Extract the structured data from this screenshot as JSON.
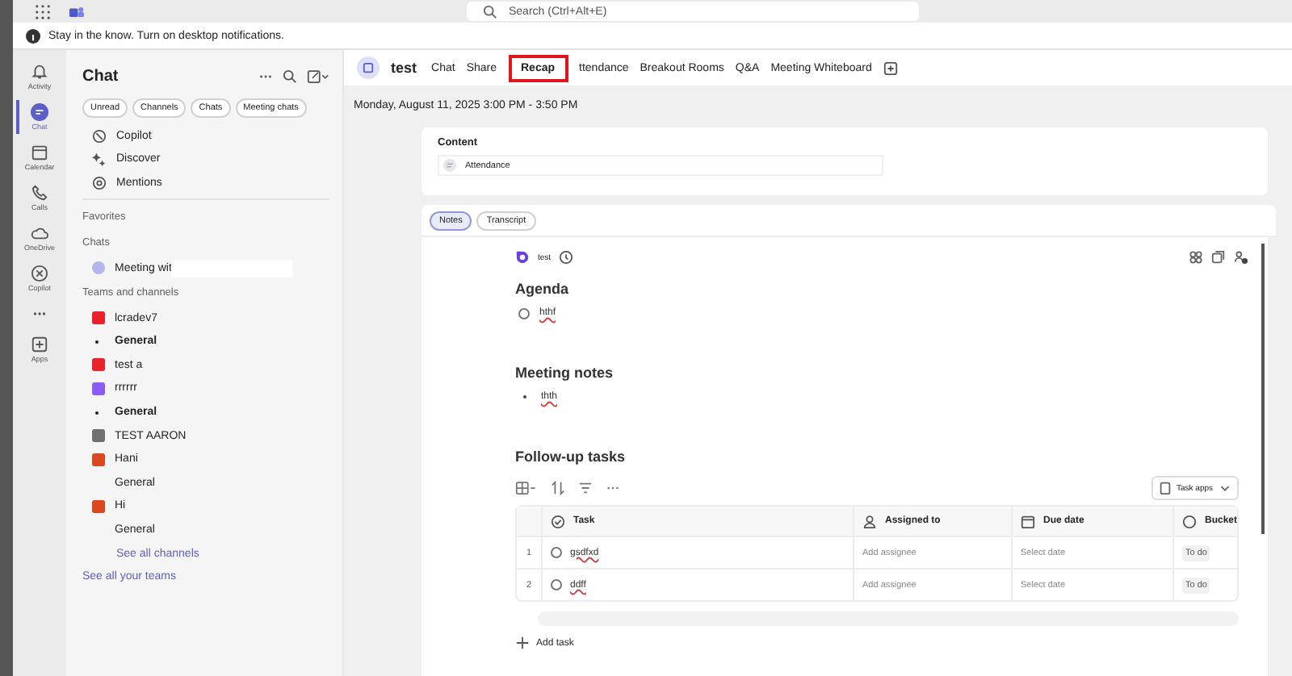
{
  "top_bar": {
    "search": {
      "placeholder": "Search (Ctrl+Alt+E)"
    }
  },
  "notification": {
    "text": "Stay in the know. Turn on desktop notifications."
  },
  "rail": [
    {
      "label": "Activity",
      "selected": false
    },
    {
      "label": "Chat",
      "selected": true
    },
    {
      "label": "Calendar",
      "selected": false
    },
    {
      "label": "Calls",
      "selected": false
    },
    {
      "label": "OneDrive",
      "selected": false
    },
    {
      "label": "Copilot",
      "selected": false
    },
    {
      "selected": false
    },
    {
      "label": "Apps",
      "selected": false
    }
  ],
  "chat_pane": {
    "title": "Chat",
    "filters": [
      "Unread",
      "Channels",
      "Chats",
      "Meeting chats"
    ],
    "shortcuts": [
      "Copilot",
      "Discover",
      "Mentions"
    ],
    "favorites_label": "Favorites",
    "chats_label": "Chats",
    "chats": [
      {
        "name": "Meeting wit",
        "redacted": true
      }
    ],
    "teams_label": "Teams and channels",
    "teams": [
      {
        "name": "lcradev7",
        "color": "#e8212b",
        "channels": [
          {
            "name": "General",
            "bold": true
          }
        ]
      },
      {
        "name": "test a",
        "color": "#e8212b"
      },
      {
        "name": "rrrrrr",
        "color": "#8b5cf6",
        "channels": [
          {
            "name": "General",
            "bold": true
          }
        ]
      },
      {
        "name": "TEST AARON",
        "color": "#707070"
      },
      {
        "name": "Hani",
        "color": "#d9481e",
        "channels": [
          {
            "name": "General",
            "bold": false
          }
        ]
      },
      {
        "name": "Hi",
        "color": "#d9481e",
        "channels": [
          {
            "name": "General",
            "bold": false
          }
        ]
      }
    ],
    "see_all_channels": "See all channels",
    "see_all_teams": "See all your teams"
  },
  "meeting": {
    "title": "test",
    "tabs": [
      {
        "label": "Chat",
        "selected": false,
        "highlighted": false
      },
      {
        "label": "Share",
        "selected": false,
        "highlighted": false
      },
      {
        "label": "Recap",
        "selected": true,
        "highlighted": true
      },
      {
        "label": "ttendance",
        "selected": false,
        "highlighted": false
      },
      {
        "label": "Breakout Rooms",
        "selected": false,
        "highlighted": false
      },
      {
        "label": "Q&A",
        "selected": false,
        "highlighted": false
      },
      {
        "label": "Meeting Whiteboard",
        "selected": false,
        "highlighted": false
      }
    ],
    "date": "Monday, August 11, 2025 3:00 PM - 3:50 PM",
    "content": {
      "title": "Content",
      "file": "Attendance"
    },
    "views": [
      {
        "label": "Notes",
        "selected": true
      },
      {
        "label": "Transcript",
        "selected": false
      }
    ],
    "notes": {
      "author": "test",
      "sections": [
        {
          "heading": "Agenda",
          "kind": "radio",
          "items": [
            "hthf"
          ]
        },
        {
          "heading": "Meeting notes",
          "kind": "bullet",
          "items": [
            "thth"
          ]
        }
      ],
      "tasks_heading": "Follow-up tasks",
      "task_apps": "Task apps",
      "columns": [
        "Task",
        "Assigned to",
        "Due date",
        "Bucket"
      ],
      "rows": [
        {
          "number": "1",
          "task": "gsdfxd",
          "assignee": "Add assignee",
          "due": "Select date",
          "bucket": "To do"
        },
        {
          "number": "2",
          "task": "ddff",
          "assignee": "Add assignee",
          "due": "Select date",
          "bucket": "To do"
        }
      ],
      "add_task": "Add task"
    }
  }
}
